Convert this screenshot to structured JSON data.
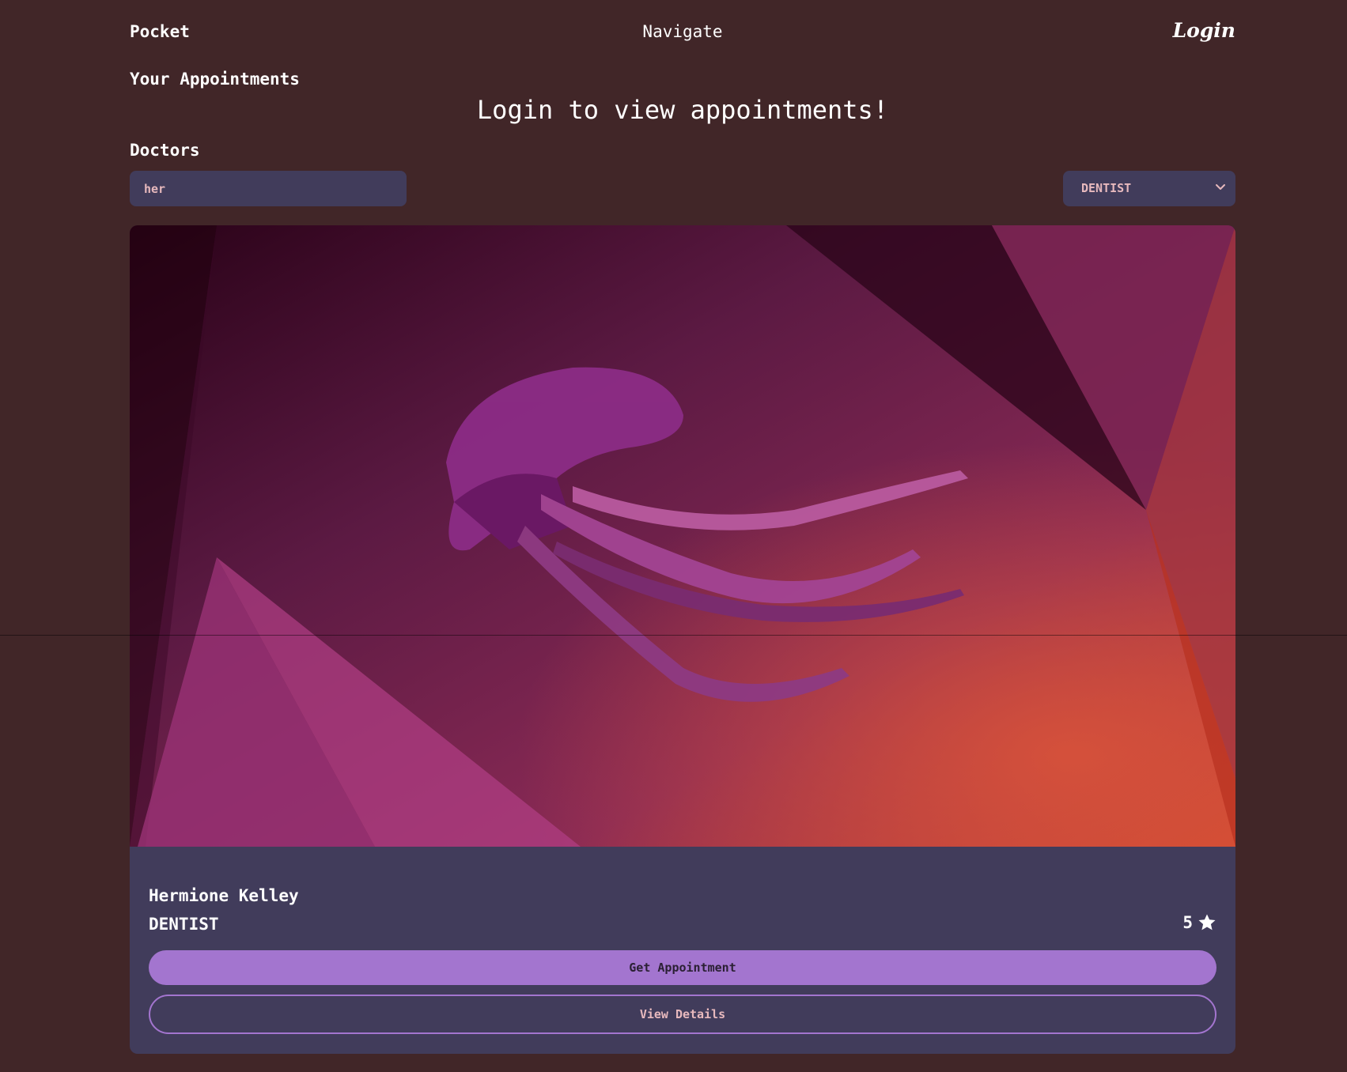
{
  "navbar": {
    "brand": "Pocket",
    "navigate": "Navigate",
    "login": "Login"
  },
  "appointments": {
    "title": "Your Appointments",
    "message": "Login to view appointments!"
  },
  "doctors": {
    "title": "Doctors",
    "search_value": "her",
    "specialty_filter": "DENTIST"
  },
  "doctor_card": {
    "image_icon": "jellyfish-wallpaper-image",
    "name": "Hermione Kelley",
    "specialty": "DENTIST",
    "rating": "5",
    "rating_icon": "star-icon",
    "primary_button": "Get Appointment",
    "secondary_button": "View Details"
  },
  "colors": {
    "background": "#412628",
    "surface": "#413c5b",
    "accent": "#a375cf",
    "muted_text": "#e7b9bd"
  }
}
